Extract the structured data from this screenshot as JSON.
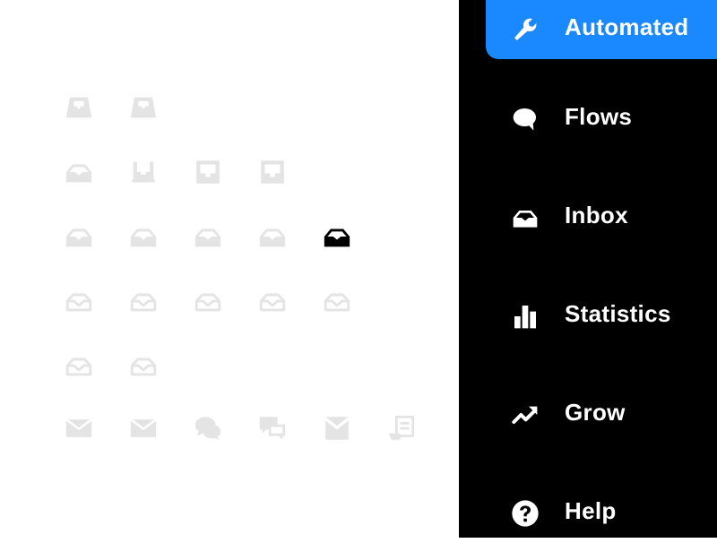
{
  "colors": {
    "canvas_bg": "#ffffff",
    "icon_muted": "#e4e4e4",
    "icon_selected": "#000000",
    "sidebar_bg": "#000000",
    "active_bg": "#1a88ff",
    "nav_text": "#ffffff"
  },
  "icon_grid": {
    "rows": [
      [
        "tray-icon",
        "tray-icon"
      ],
      [
        "inbox-filled-icon",
        "tray-slot-icon",
        "tray-square-icon",
        "tray-square-icon"
      ],
      [
        "inbox-filled-icon",
        "inbox-filled-icon",
        "inbox-filled-icon",
        "inbox-filled-icon",
        "inbox-filled-icon"
      ],
      [
        "inbox-outline-icon",
        "inbox-outline-icon",
        "inbox-outline-icon",
        "inbox-outline-icon",
        "inbox-outline-icon"
      ],
      [
        "inbox-outline-icon",
        "inbox-outline-icon"
      ],
      [
        "envelope-icon",
        "envelope-icon",
        "chat-bubbles-icon",
        "chat-bubbles-square-icon",
        "envelope-tray-icon",
        "note-icon"
      ]
    ],
    "selected": {
      "row": 2,
      "col": 4
    }
  },
  "sidebar": {
    "active_index": 0,
    "items": [
      {
        "label": "Automated",
        "icon": "wrench-icon"
      },
      {
        "label": "Flows",
        "icon": "chat-bubble-icon"
      },
      {
        "label": "Inbox",
        "icon": "inbox-icon"
      },
      {
        "label": "Statistics",
        "icon": "bar-chart-icon"
      },
      {
        "label": "Grow",
        "icon": "trend-up-icon"
      },
      {
        "label": "Help",
        "icon": "help-circle-icon"
      }
    ]
  }
}
